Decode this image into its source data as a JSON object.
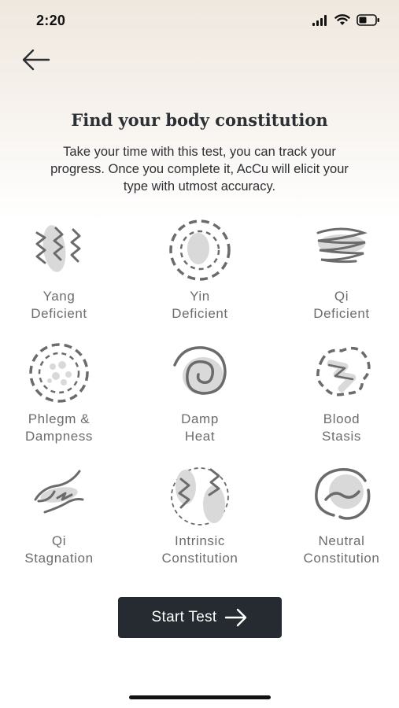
{
  "status": {
    "time": "2:20",
    "icons": [
      "signal-icon",
      "wifi-icon",
      "battery-icon"
    ]
  },
  "header": {
    "back_icon": "arrow-left-icon",
    "title": "Find your body constitution",
    "subtitle": "Take your time with this test, you can track your progress. Once you complete it, AcCu will elicit your type with utmost accuracy."
  },
  "constitutions": [
    {
      "line1": "Yang",
      "line2": "Deficient",
      "icon": "yang-deficient-icon"
    },
    {
      "line1": "Yin",
      "line2": "Deficient",
      "icon": "yin-deficient-icon"
    },
    {
      "line1": "Qi",
      "line2": "Deficient",
      "icon": "qi-deficient-icon"
    },
    {
      "line1": "Phlegm &",
      "line2": "Dampness",
      "icon": "phlegm-dampness-icon"
    },
    {
      "line1": "Damp",
      "line2": "Heat",
      "icon": "damp-heat-icon"
    },
    {
      "line1": "Blood",
      "line2": "Stasis",
      "icon": "blood-stasis-icon"
    },
    {
      "line1": "Qi",
      "line2": "Stagnation",
      "icon": "qi-stagnation-icon"
    },
    {
      "line1": "Intrinsic",
      "line2": "Constitution",
      "icon": "intrinsic-constitution-icon"
    },
    {
      "line1": "Neutral",
      "line2": "Constitution",
      "icon": "neutral-constitution-icon"
    }
  ],
  "cta": {
    "label": "Start Test",
    "icon": "arrow-right-icon"
  },
  "colors": {
    "stroke": "#6b6b6b",
    "fill": "#d9d9d9",
    "button": "#262b31",
    "label": "#6c6c6c"
  }
}
